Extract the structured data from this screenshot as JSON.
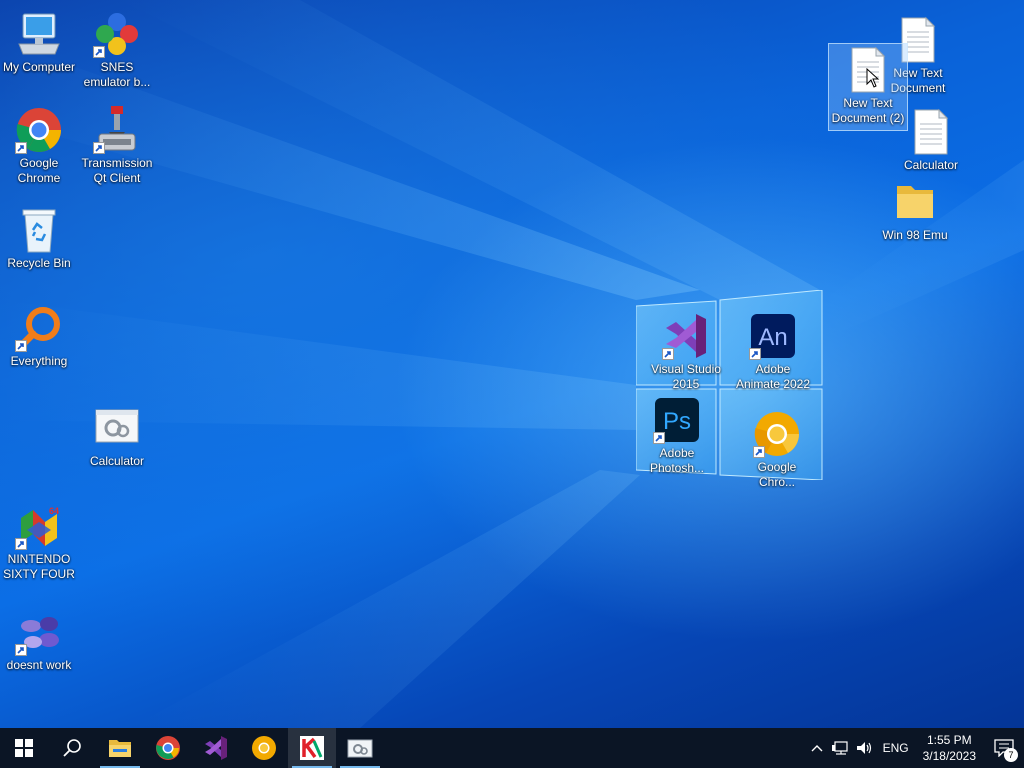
{
  "desktop": {
    "left_icons": [
      {
        "label": "My Computer",
        "icon": "computer-icon"
      },
      {
        "label": "SNES emulator b...",
        "icon": "snes-icon"
      },
      {
        "label": "Google Chrome",
        "icon": "chrome-icon"
      },
      {
        "label": "Transmission Qt Client",
        "icon": "transmission-icon"
      },
      {
        "label": "Recycle Bin",
        "icon": "recycle-bin-icon"
      },
      {
        "label": "Everything",
        "icon": "everything-search-icon"
      },
      {
        "label": "Calculator",
        "icon": "calculator-icon"
      },
      {
        "label": "NINTENDO SIXTY FOUR",
        "icon": "n64-icon"
      },
      {
        "label": "doesnt work",
        "icon": "emulator-icon"
      }
    ],
    "center_icons": [
      {
        "label": "Visual Studio 2015",
        "icon": "visual-studio-icon"
      },
      {
        "label": "Adobe Animate 2022",
        "icon": "adobe-animate-icon",
        "text": "An"
      },
      {
        "label": "Adobe Photosh...",
        "icon": "adobe-photoshop-icon",
        "text": "Ps"
      },
      {
        "label": "Google Chro...",
        "icon": "chrome-canary-icon"
      }
    ],
    "right_icons": [
      {
        "label": "New Text Document",
        "icon": "text-document-icon"
      },
      {
        "label": "New Text Document (2)",
        "icon": "text-document-icon",
        "selected": true
      },
      {
        "label": "Calculator",
        "icon": "text-document-icon"
      },
      {
        "label": "Win 98 Emu",
        "icon": "folder-icon"
      }
    ]
  },
  "taskbar": {
    "apps": [
      {
        "name": "start-button",
        "icon": "windows-logo-icon"
      },
      {
        "name": "search-button",
        "icon": "search-icon"
      },
      {
        "name": "file-explorer",
        "icon": "folder-icon",
        "running": true
      },
      {
        "name": "chrome",
        "icon": "chrome-icon"
      },
      {
        "name": "visual-studio",
        "icon": "visual-studio-icon"
      },
      {
        "name": "chrome-canary",
        "icon": "chrome-canary-icon"
      },
      {
        "name": "kaspersky",
        "icon": "kaspersky-icon",
        "running": true,
        "active": true
      },
      {
        "name": "calculator-app",
        "icon": "calculator-icon",
        "running": true
      }
    ],
    "tray": {
      "language": "ENG",
      "time": "1:55 PM",
      "date": "3/18/2023",
      "notification_count": "7"
    }
  },
  "colors": {
    "taskbar_bg": "#0b1525",
    "running_indicator": "#76b9ed",
    "desktop_blue": "#0a62d8"
  }
}
